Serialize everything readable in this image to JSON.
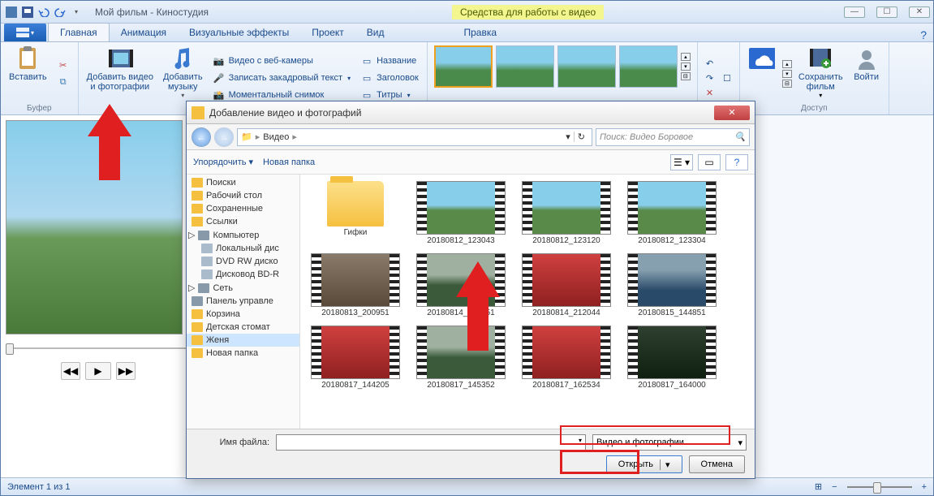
{
  "titlebar": {
    "title": "Мой фильм - Киностудия",
    "context_tab": "Средства для работы с видео"
  },
  "ribbon": {
    "tabs": [
      "Главная",
      "Анимация",
      "Визуальные эффекты",
      "Проект",
      "Вид",
      "Правка"
    ],
    "active_tab": "Главная",
    "file_dropdown": "▾",
    "help_icon": "?",
    "group_clipboard": "Буфер",
    "paste": "Вставить",
    "cut_icon": "✂",
    "copy_icon": "⧉",
    "add_videos": "Добавить видео\nи фотографии",
    "add_music": "Добавить\nмузыку",
    "music_dd": "▾",
    "webcam": "Видео с веб-камеры",
    "narration": "Записать закадровый текст",
    "snapshot": "Моментальный снимок",
    "name_btn": "Название",
    "header_btn": "Заголовок",
    "titles_btn": "Титры",
    "group_access": "Доступ",
    "save_movie": "Сохранить\nфильм",
    "sign_in": "Войти"
  },
  "status": {
    "element": "Элемент 1 из 1",
    "minus": "−",
    "plus": "+"
  },
  "dialog": {
    "title": "Добавление видео и фотографий",
    "close": "✕",
    "nav_back": "←",
    "nav_fwd": "→",
    "crumb_root": "▸",
    "crumb_video": "Видео",
    "crumb_dd": "▾",
    "search_placeholder": "Поиск: Видео Боровое",
    "organize": "Упорядочить",
    "new_folder": "Новая папка",
    "tree": [
      "Поиски",
      "Рабочий стол",
      "Сохраненные",
      "Ссылки",
      "Компьютер",
      "Локальный дис",
      "DVD RW диско",
      "Дисковод BD-R",
      "Сеть",
      "Панель управле",
      "Корзина",
      "Детская стомат",
      "Женя",
      "Новая папка"
    ],
    "files": [
      {
        "name": "Гифки",
        "type": "folder"
      },
      {
        "name": "20180812_123043",
        "type": "video",
        "scene": "sky-grass"
      },
      {
        "name": "20180812_123120",
        "type": "video",
        "scene": "sky-grass"
      },
      {
        "name": "20180812_123304",
        "type": "video",
        "scene": "sky-grass"
      },
      {
        "name": "20180813_200951",
        "type": "video",
        "scene": "rocks"
      },
      {
        "name": "20180814_103551",
        "type": "video",
        "scene": "forest"
      },
      {
        "name": "20180814_212044",
        "type": "video",
        "scene": "red-scene"
      },
      {
        "name": "20180815_144851",
        "type": "video",
        "scene": "water"
      },
      {
        "name": "20180817_144205",
        "type": "video",
        "scene": "red-scene"
      },
      {
        "name": "20180817_145352",
        "type": "video",
        "scene": "forest"
      },
      {
        "name": "20180817_162534",
        "type": "video",
        "scene": "red-scene"
      },
      {
        "name": "20180817_164000",
        "type": "video",
        "scene": "dark"
      }
    ],
    "filename_label": "Имя файла:",
    "filter": "Видео и фотографии",
    "open": "Открыть",
    "cancel": "Отмена"
  }
}
